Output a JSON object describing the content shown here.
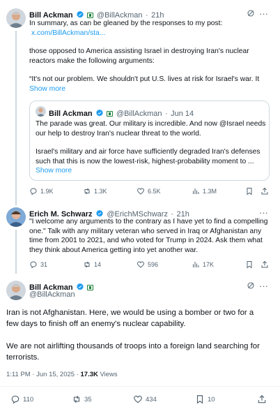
{
  "tweet1": {
    "author": "Bill Ackman",
    "handle": "@BillAckman",
    "time": "21h",
    "line1": "In summary, as can be gleaned by the responses to my post:",
    "link": "x.com/BillAckman/sta...",
    "line2": "those opposed to America assisting Israel in destroying Iran's nuclear",
    "line3": "reactors make the following arguments:",
    "line4": "“It's not our problem. We shouldn't put U.S. lives at risk for Israel's war. It",
    "show_more": "Show more",
    "quote": {
      "author": "Bill Ackman",
      "handle": "@BillAckman",
      "time": "Jun 14",
      "line1": "The parade was great. Our military is incredible. And now @Israel needs",
      "line2": "our help to destroy Iran's nuclear threat to the world.",
      "line3": "Israel's military and air force have sufficiently degraded Iran's defenses",
      "line4": "such that this is now the lowest-risk, highest-probability moment to ...",
      "show_more": "Show more"
    },
    "stats": {
      "replies": "1.9K",
      "reposts": "1.3K",
      "likes": "6.5K",
      "views": "1.3M"
    }
  },
  "tweet2": {
    "author": "Erich M. Schwarz",
    "handle": "@ErichMSchwarz",
    "time": "21h",
    "line1": "\"I welcome any arguments to the contrary as I have yet to find a compelling",
    "line2": "one.\"  Talk with any military veteran who served in Iraq or Afghanistan any",
    "line3": "time from 2001 to 2021, and who voted for Trump in 2024.  Ask them what",
    "line4": "they think about America getting into yet another war.",
    "stats": {
      "replies": "31",
      "reposts": "14",
      "likes": "596",
      "views": "17K"
    }
  },
  "tweet3": {
    "author": "Bill Ackman",
    "handle": "@BillAckman",
    "para1_line1": "Iran is not Afghanistan. Here, we would be using a bomber or two for a",
    "para1_line2": "few days to finish off an enemy's nuclear capability.",
    "para2_line1": "We are not airlifting thousands of troops into a foreign land searching for",
    "para2_line2": "terrorists.",
    "timestamp": "1:11 PM · Jun 15, 2025 · ",
    "views_count": "17.3K",
    "views_label": " Views",
    "stats": {
      "replies": "110",
      "reposts": "35",
      "likes": "434",
      "bookmarks": "10"
    }
  },
  "colors": {
    "accent": "#1d9bf0",
    "text": "#0f1419",
    "muted": "#536471",
    "border": "#cfd9de"
  }
}
